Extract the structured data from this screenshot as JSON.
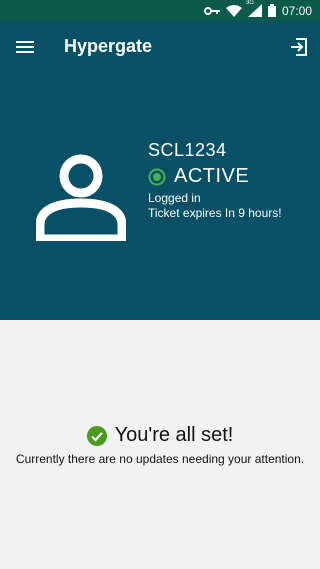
{
  "status_bar": {
    "time": "07:00",
    "icons": [
      "key-icon",
      "wifi-icon",
      "signal-icon",
      "battery-icon"
    ],
    "network_label": "3G"
  },
  "app_bar": {
    "title": "Hypergate",
    "menu_icon": "hamburger-menu-icon",
    "logout_icon": "logout-icon"
  },
  "user": {
    "id": "SCL1234",
    "status": "ACTIVE",
    "logged_in_text": "Logged in",
    "ticket_text": "Ticket expires In 9 hours!"
  },
  "content": {
    "title": "You're all set!",
    "subtitle": "Currently there are no updates needing your attention."
  },
  "colors": {
    "status_bar": "#0a5a4c",
    "primary": "#075066",
    "active_green": "#4caf50",
    "success_green": "#4a9a1f",
    "background": "#f2f2f2"
  }
}
